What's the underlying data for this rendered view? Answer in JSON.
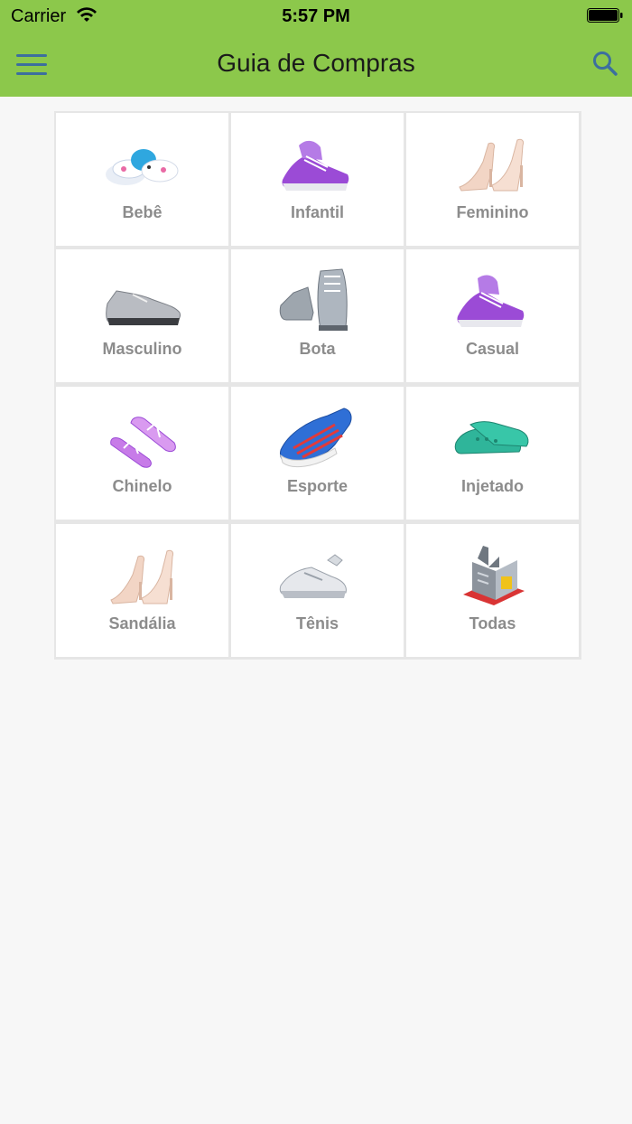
{
  "status_bar": {
    "carrier": "Carrier",
    "time": "5:57 PM"
  },
  "header": {
    "title": "Guia de Compras",
    "background_color": "#8cc84b",
    "icon_color": "#3c6f9e"
  },
  "categories": [
    {
      "label": "Bebê",
      "icon": "baby-shoe-icon"
    },
    {
      "label": "Infantil",
      "icon": "purple-sneaker-icon"
    },
    {
      "label": "Feminino",
      "icon": "high-heel-icon"
    },
    {
      "label": "Masculino",
      "icon": "dress-shoe-icon"
    },
    {
      "label": "Bota",
      "icon": "boot-icon"
    },
    {
      "label": "Casual",
      "icon": "casual-sneaker-icon"
    },
    {
      "label": "Chinelo",
      "icon": "flip-flop-icon"
    },
    {
      "label": "Esporte",
      "icon": "sport-shoe-icon"
    },
    {
      "label": "Injetado",
      "icon": "injected-shoe-icon"
    },
    {
      "label": "Sandália",
      "icon": "sandal-heel-icon"
    },
    {
      "label": "Tênis",
      "icon": "tennis-shoe-icon"
    },
    {
      "label": "Todas",
      "icon": "factory-icon"
    }
  ]
}
